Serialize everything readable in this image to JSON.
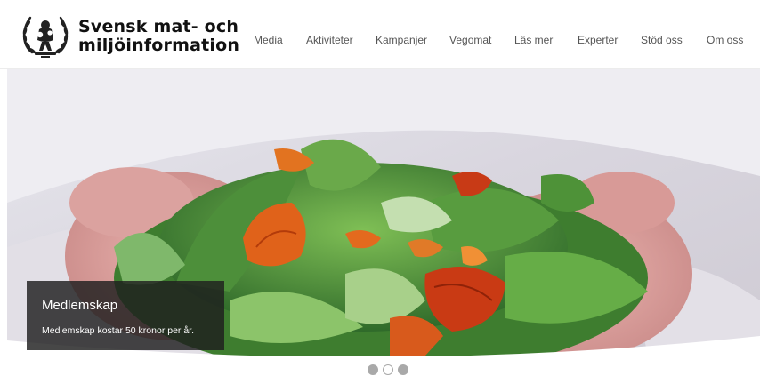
{
  "logo": {
    "line1": "Svensk mat- och",
    "line2": "miljöinformation",
    "emblem_icon": "wreath-emblem-icon"
  },
  "nav": {
    "items": [
      {
        "label": "Media"
      },
      {
        "label": "Aktiviteter"
      },
      {
        "label": "Kampanjer"
      },
      {
        "label": "Vegomat"
      },
      {
        "label": "Läs mer"
      },
      {
        "label": "Experter"
      },
      {
        "label": "Stöd oss"
      },
      {
        "label": "Om oss"
      }
    ]
  },
  "slider": {
    "image_icon": "salad-photo",
    "caption_title": "Medlemskap",
    "caption_text": "Medlemskap kostar 50 kronor per år.",
    "slide_count": 3,
    "active_slide": 2
  },
  "colors": {
    "nav_text": "#555555",
    "caption_bg": "#1e1e1e",
    "dot": "#a9a9a9"
  }
}
